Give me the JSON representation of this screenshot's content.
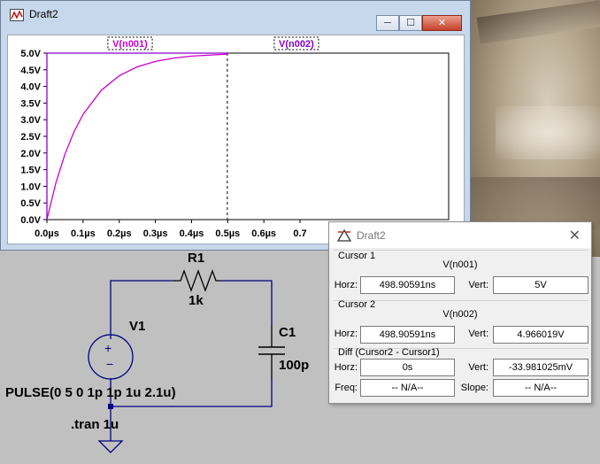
{
  "plot_window": {
    "title": "Draft2",
    "traces": [
      "V(n001)",
      "V(n002)"
    ],
    "trace_colors": [
      "#cc00cc",
      "#8800cc"
    ],
    "controls": {
      "minimize": "─",
      "maximize": "☐",
      "close": "✕"
    }
  },
  "chart_data": {
    "type": "line",
    "x": [
      0,
      0.025,
      0.05,
      0.075,
      0.1,
      0.15,
      0.2,
      0.25,
      0.3,
      0.35,
      0.4,
      0.45,
      0.5
    ],
    "series": [
      {
        "name": "V(n001)",
        "values": [
          0,
          1.11,
          1.97,
          2.64,
          3.16,
          3.88,
          4.32,
          4.59,
          4.75,
          4.85,
          4.91,
          4.94,
          4.97
        ]
      }
    ],
    "xlim": [
      0,
      1.0
    ],
    "ylim": [
      0,
      5.0
    ],
    "x_ticks": [
      "0.0µs",
      "0.1µs",
      "0.2µs",
      "0.3µs",
      "0.4µs",
      "0.5µs",
      "0.6µs",
      "0.7"
    ],
    "y_ticks": [
      "0.0V",
      "0.5V",
      "1.0V",
      "1.5V",
      "2.0V",
      "2.5V",
      "3.0V",
      "3.5V",
      "4.0V",
      "4.5V",
      "5.0V"
    ],
    "cursor_x": 0.4989,
    "grid": false
  },
  "schematic": {
    "r1_name": "R1",
    "r1_value": "1k",
    "c1_name": "C1",
    "c1_value": "100p",
    "v1_name": "V1",
    "source_spec": "PULSE(0 5 0 1p 1p 1u 2.1u)",
    "directive": ".tran 1u",
    "source_plus": "+",
    "source_minus": "−"
  },
  "cursor_dialog": {
    "title": "Draft2",
    "close": "✕",
    "cursor1": {
      "group": "Cursor 1",
      "trace": "V(n001)",
      "horz_label": "Horz:",
      "horz": "498.90591ns",
      "vert_label": "Vert:",
      "vert": "5V"
    },
    "cursor2": {
      "group": "Cursor 2",
      "trace": "V(n002)",
      "horz_label": "Horz:",
      "horz": "498.90591ns",
      "vert_label": "Vert:",
      "vert": "4.966019V"
    },
    "diff": {
      "group": "Diff (Cursor2 - Cursor1)",
      "horz_label": "Horz:",
      "horz": "0s",
      "vert_label": "Vert:",
      "vert": "-33.981025mV",
      "freq_label": "Freq:",
      "freq": "-- N/A--",
      "slope_label": "Slope:",
      "slope": "-- N/A--"
    }
  }
}
